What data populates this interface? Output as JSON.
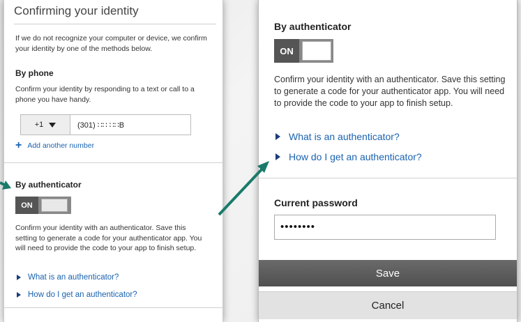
{
  "left": {
    "title": "Confirming your identity",
    "intro": "If we do not recognize your computer or device, we confirm your identity by one of the methods below.",
    "phone_heading": "By phone",
    "phone_desc": "Confirm your identity by responding to a text or call to a phone you have handy.",
    "country_code": "+1",
    "phone_number": "(301) ∷∷ ∷∷B",
    "add_number": "Add another number",
    "auth_heading": "By authenticator",
    "toggle_label": "ON",
    "auth_desc": "Confirm your identity with an authenticator. Save this setting to generate a code for your authenticator app. You will need to provide the code to your app to finish setup.",
    "link_what": "What is an authenticator?",
    "link_how": "How do I get an authenticator?"
  },
  "right": {
    "auth_heading": "By authenticator",
    "toggle_label": "ON",
    "auth_desc": "Confirm your identity with an authenticator. Save this setting to generate a code for your authenticator app. You will need to provide the code to your app to finish setup.",
    "link_what": "What is an authenticator?",
    "link_how": "How do I get an authenticator?",
    "password_label": "Current password",
    "password_value": "••••••••",
    "save_label": "Save",
    "cancel_label": "Cancel"
  },
  "colors": {
    "link": "#1a63b0",
    "arrow": "#1a7a6a",
    "save_bg": "#5c5c5c"
  }
}
